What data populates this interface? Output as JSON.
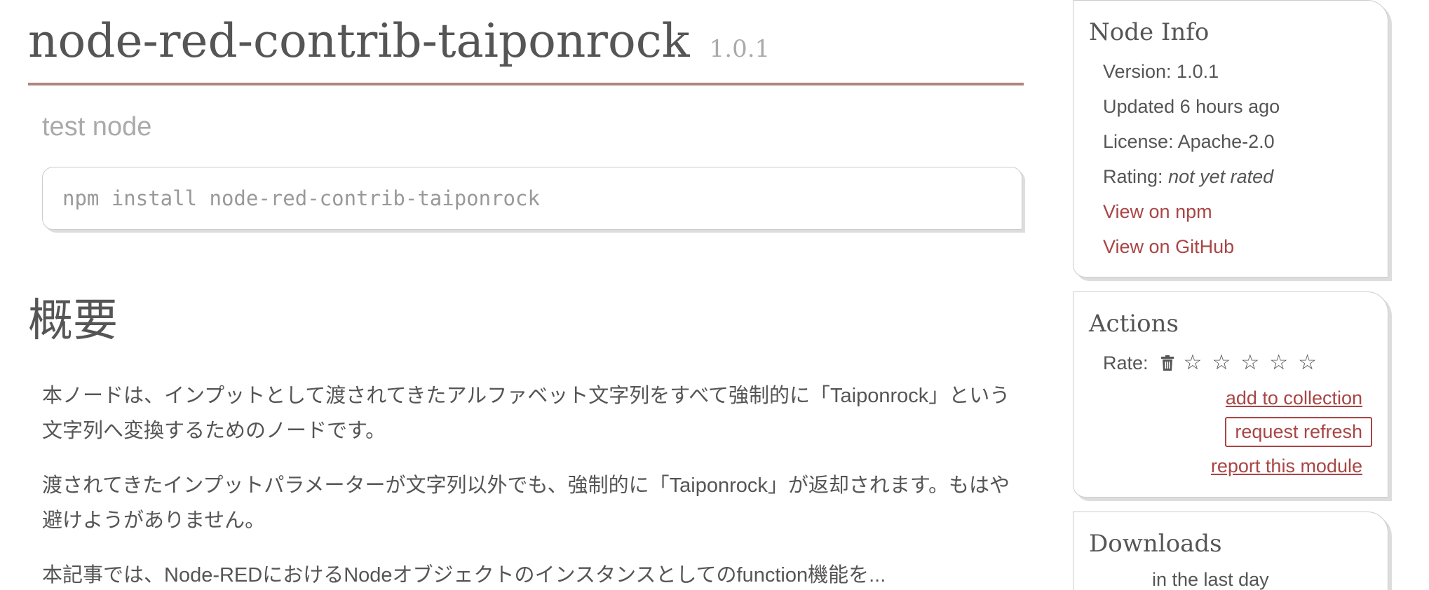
{
  "package": {
    "name": "node-red-contrib-taiponrock",
    "version": "1.0.1",
    "description": "test node",
    "install_command": "npm install node-red-contrib-taiponrock"
  },
  "readme": {
    "heading": "概要",
    "paragraphs": [
      "本ノードは、インプットとして渡されてきたアルファベット文字列をすべて強制的に「Taiponrock」という文字列へ変換するためのノードです。",
      "渡されてきたインプットパラメーターが文字列以外でも、強制的に「Taiponrock」が返却されます。もはや避けようがありません。",
      "本記事では、Node-REDにおけるNodeオブジェクトのインスタンスとしてのfunction機能を..."
    ]
  },
  "node_info": {
    "title": "Node Info",
    "version_label": "Version: 1.0.1",
    "updated_label": "Updated 6 hours ago",
    "license_label": "License: Apache-2.0",
    "rating_label": "Rating: ",
    "rating_value": "not yet rated",
    "npm_link": "View on npm",
    "github_link": "View on GitHub"
  },
  "actions": {
    "title": "Actions",
    "rate_label": "Rate:",
    "stars": [
      "☆",
      "☆",
      "☆",
      "☆",
      "☆"
    ],
    "add_to_collection": "add to collection",
    "request_refresh": "request refresh",
    "report_module": "report this module"
  },
  "downloads": {
    "title": "Downloads",
    "last_day": "in the last day"
  },
  "colors": {
    "accent": "#a94545",
    "title_rule": "#b08580",
    "muted": "#aaaaaa",
    "text": "#555555"
  },
  "icons": {
    "clear_rating": "trash-icon",
    "star": "star-outline-icon"
  }
}
